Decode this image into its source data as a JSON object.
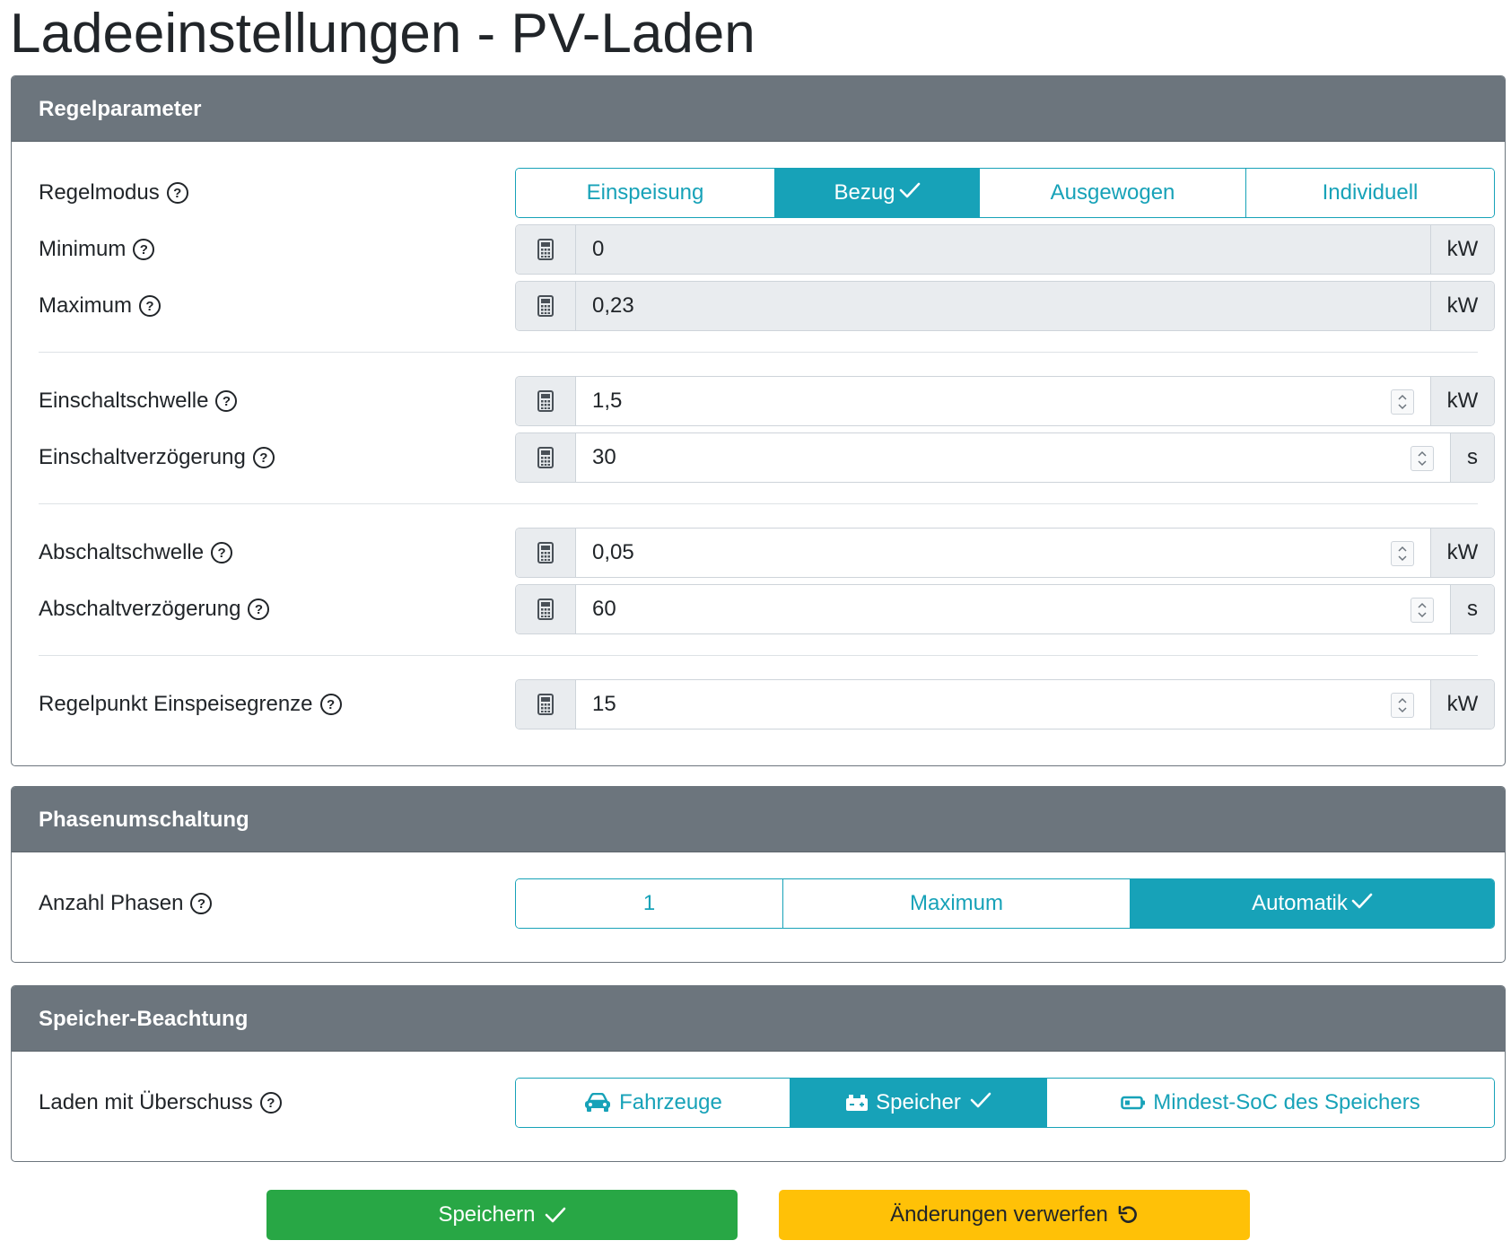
{
  "page": {
    "title": "Ladeeinstellungen - PV-Laden"
  },
  "sections": {
    "regelparameter": {
      "title": "Regelparameter",
      "regelmodus": {
        "label": "Regelmodus",
        "options": [
          "Einspeisung",
          "Bezug",
          "Ausgewogen",
          "Individuell"
        ],
        "selected": "Bezug"
      },
      "minimum": {
        "label": "Minimum",
        "value": "0",
        "unit": "kW"
      },
      "maximum": {
        "label": "Maximum",
        "value": "0,23",
        "unit": "kW"
      },
      "einschaltschwelle": {
        "label": "Einschaltschwelle",
        "value": "1,5",
        "unit": "kW"
      },
      "einschaltverzoegerung": {
        "label": "Einschaltverzögerung",
        "value": "30",
        "unit": "s"
      },
      "abschaltschwelle": {
        "label": "Abschaltschwelle",
        "value": "0,05",
        "unit": "kW"
      },
      "abschaltverzoegerung": {
        "label": "Abschaltverzögerung",
        "value": "60",
        "unit": "s"
      },
      "regelpunkt": {
        "label": "Regelpunkt Einspeisegrenze",
        "value": "15",
        "unit": "kW"
      }
    },
    "phasenumschaltung": {
      "title": "Phasenumschaltung",
      "anzahl_phasen": {
        "label": "Anzahl Phasen",
        "options": [
          "1",
          "Maximum",
          "Automatik"
        ],
        "selected": "Automatik"
      }
    },
    "speicher": {
      "title": "Speicher-Beachtung",
      "laden_mit_ueberschuss": {
        "label": "Laden mit Überschuss",
        "options": [
          "Fahrzeuge",
          "Speicher",
          "Mindest-SoC des Speichers"
        ],
        "option_icons": [
          "car-icon",
          "battery-storage-icon",
          "battery-icon"
        ],
        "selected": "Speicher"
      }
    }
  },
  "actions": {
    "save_label": "Speichern",
    "discard_label": "Änderungen verwerfen"
  },
  "help_glyph": "?",
  "colors": {
    "accent": "#17a2b8",
    "header": "#6c757d",
    "save": "#28a745",
    "discard": "#ffc107"
  }
}
